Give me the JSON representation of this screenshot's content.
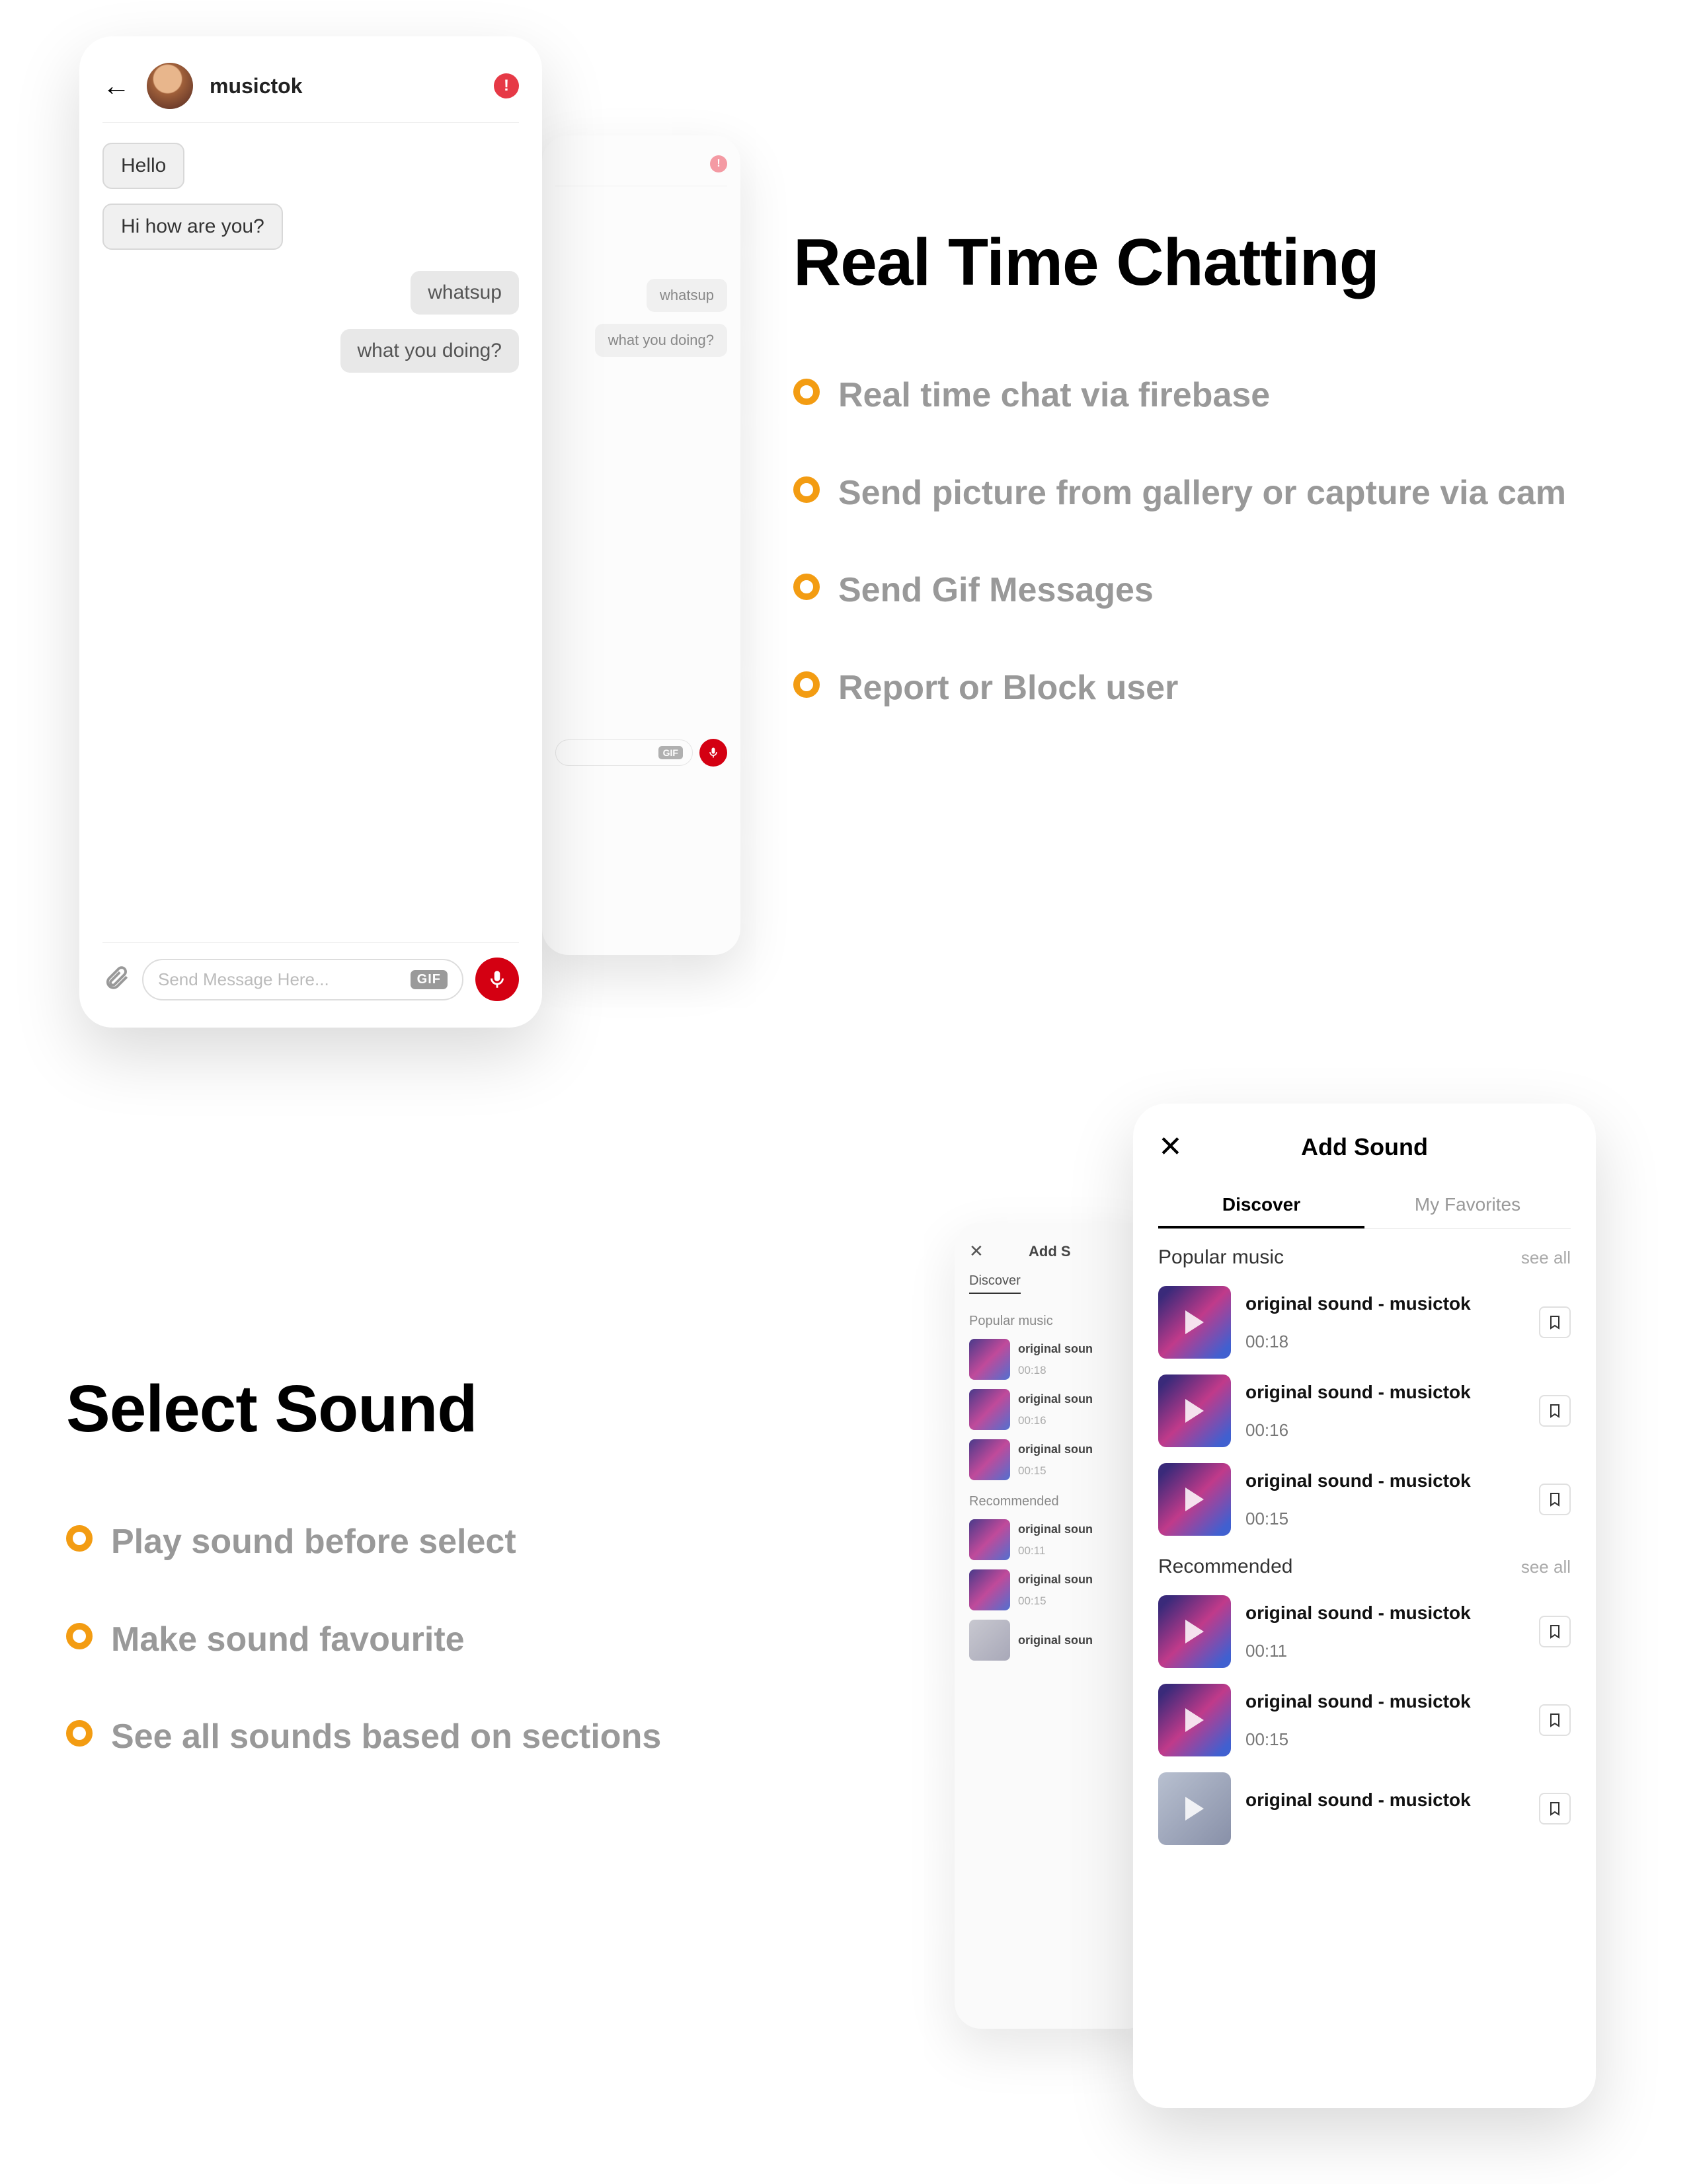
{
  "section1": {
    "title": "Real Time Chatting",
    "features": [
      "Real time chat via firebase",
      "Send picture from gallery or capture via cam",
      "Send Gif Messages",
      "Report or Block user"
    ],
    "phone_front": {
      "username": "musictok",
      "alert": "!",
      "messages_in": [
        "Hello",
        "Hi how are you?"
      ],
      "messages_out": [
        "whatsup",
        "what you doing?"
      ],
      "input_placeholder": "Send Message Here...",
      "gif_label": "GIF"
    },
    "phone_back": {
      "alert": "!",
      "messages_out": [
        "whatsup",
        "what you doing?"
      ],
      "gif_label": "GIF"
    }
  },
  "section2": {
    "title": "Select Sound",
    "features": [
      "Play sound before select",
      "Make sound favourite",
      "See all sounds based on sections"
    ],
    "phone_front": {
      "header": "Add Sound",
      "tabs": {
        "discover": "Discover",
        "favorites": "My Favorites"
      },
      "see_all": "see all",
      "sections": {
        "popular": {
          "label": "Popular music",
          "items": [
            {
              "name": "original sound - musictok",
              "time": "00:18"
            },
            {
              "name": "original sound - musictok",
              "time": "00:16"
            },
            {
              "name": "original sound - musictok",
              "time": "00:15"
            }
          ]
        },
        "recommended": {
          "label": "Recommended",
          "items": [
            {
              "name": "original sound - musictok",
              "time": "00:11"
            },
            {
              "name": "original sound - musictok",
              "time": "00:15"
            },
            {
              "name": "original sound - musictok",
              "time": ""
            }
          ]
        }
      }
    },
    "phone_back": {
      "header": "Add S",
      "tab": "Discover",
      "sections": {
        "popular": {
          "label": "Popular music",
          "items": [
            {
              "name": "original soun",
              "time": "00:18"
            },
            {
              "name": "original soun",
              "time": "00:16"
            },
            {
              "name": "original soun",
              "time": "00:15"
            }
          ]
        },
        "recommended": {
          "label": "Recommended",
          "items": [
            {
              "name": "original soun",
              "time": "00:11"
            },
            {
              "name": "original soun",
              "time": "00:15"
            },
            {
              "name": "original soun",
              "time": ""
            }
          ]
        }
      }
    }
  }
}
